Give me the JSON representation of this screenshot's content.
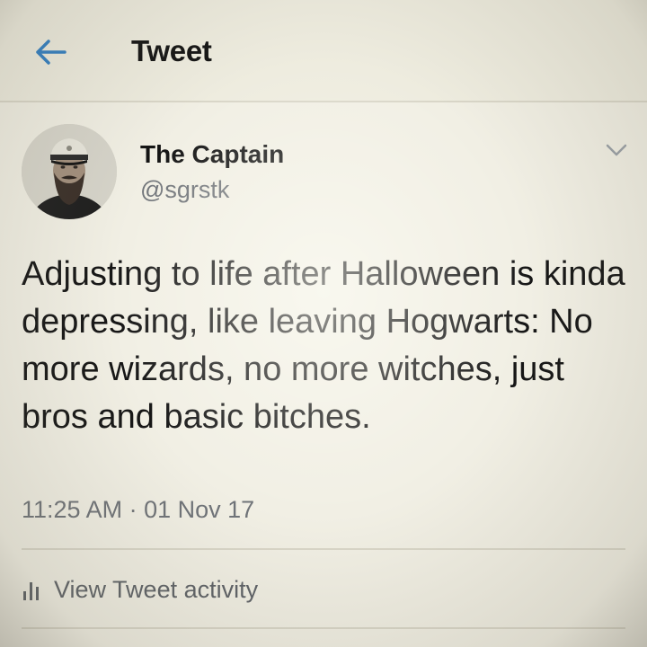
{
  "header": {
    "back_icon": "arrow-left-icon",
    "title": "Tweet",
    "accent_color": "#2f7dc2"
  },
  "tweet": {
    "author": {
      "display_name": "The Captain",
      "handle": "@sgrstk",
      "avatar": "avatar-bearded-captain"
    },
    "menu_icon": "chevron-down-icon",
    "text": "Adjusting to life after Halloween is kinda depressing, like leaving Hogwarts: No more wizards, no more witches, just bros and basic bitches.",
    "timestamp": "11:25 AM · 01 Nov 17"
  },
  "activity": {
    "icon": "bar-chart-icon",
    "label": "View Tweet activity"
  }
}
